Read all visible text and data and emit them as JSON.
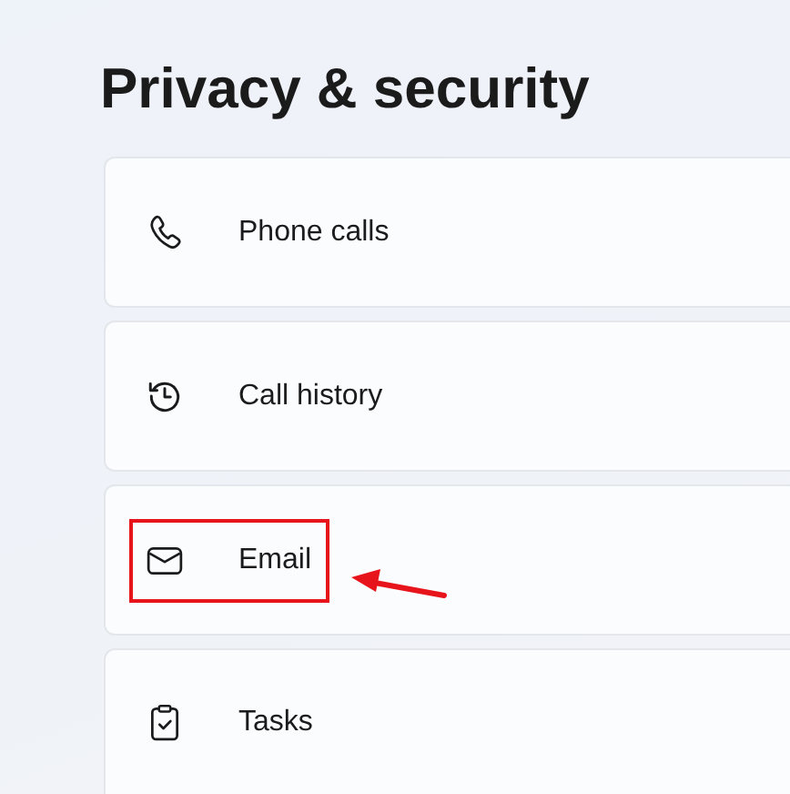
{
  "page_title": "Privacy & security",
  "items": [
    {
      "label": "Phone calls",
      "kind": "phone",
      "highlighted": false
    },
    {
      "label": "Call history",
      "kind": "history",
      "highlighted": false
    },
    {
      "label": "Email",
      "kind": "mail",
      "highlighted": true
    },
    {
      "label": "Tasks",
      "kind": "tasks",
      "highlighted": false
    }
  ]
}
